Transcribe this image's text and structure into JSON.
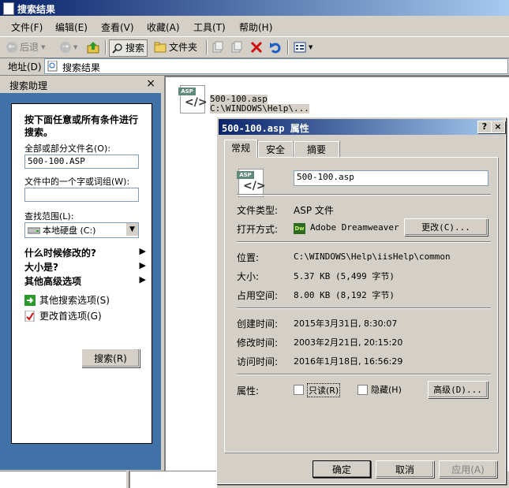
{
  "window": {
    "title": "搜索结果"
  },
  "menu": [
    "文件(F)",
    "编辑(E)",
    "查看(V)",
    "收藏(A)",
    "工具(T)",
    "帮助(H)"
  ],
  "toolbar": {
    "back": "后退",
    "search": "搜索",
    "folders": "文件夹"
  },
  "address": {
    "label": "地址(D)",
    "value": "搜索结果"
  },
  "sidebar": {
    "title": "搜索助理",
    "close": "×",
    "heading": "按下面任意或所有条件进行搜索。",
    "name_label": "全部或部分文件名(O):",
    "name_value": "500-100.ASP",
    "word_label": "文件中的一个字或词组(W):",
    "word_value": "",
    "scope_label": "查找范围(L):",
    "scope_value": "本地硬盘 (C:)",
    "modified": "什么时候修改的?",
    "size": "大小是?",
    "advanced": "其他高级选项",
    "other_options": "其他搜索选项(S)",
    "prefs": "更改首选项(G)",
    "search_button": "搜索(R)"
  },
  "results": [
    {
      "name": "500-100.asp",
      "path": "C:\\WINDOWS\\Help\\..."
    }
  ],
  "dialog": {
    "title": "500-100.asp 属性",
    "help": "?",
    "close": "×",
    "tabs": [
      "常规",
      "安全",
      "摘要"
    ],
    "filename": "500-100.asp",
    "type_label": "文件类型:",
    "type_value": "ASP 文件",
    "open_label": "打开方式:",
    "open_value": "Adobe Dreamweaver (",
    "change_button": "更改(C)...",
    "location_label": "位置:",
    "location_value": "C:\\WINDOWS\\Help\\iisHelp\\common",
    "size_label": "大小:",
    "size_value": "5.37 KB (5,499 字节)",
    "disk_label": "占用空间:",
    "disk_value": "8.00 KB (8,192 字节)",
    "created_label": "创建时间:",
    "created_value": "2015年3月31日, 8:30:07",
    "modified_label": "修改时间:",
    "modified_value": "2003年2月21日, 20:15:20",
    "accessed_label": "访问时间:",
    "accessed_value": "2016年1月18日, 16:56:29",
    "attr_label": "属性:",
    "readonly": "只读(R)",
    "hidden": "隐藏(H)",
    "advanced_button": "高级(D)...",
    "ok": "确定",
    "cancel": "取消",
    "apply": "应用(A)",
    "dw_icon": "Dw"
  },
  "icons": {
    "file_tag": "ASP",
    "file_symbol": "</>",
    "arrow_left": "←",
    "arrow_right": "→",
    "dropdown": "▼",
    "play": "▶"
  }
}
